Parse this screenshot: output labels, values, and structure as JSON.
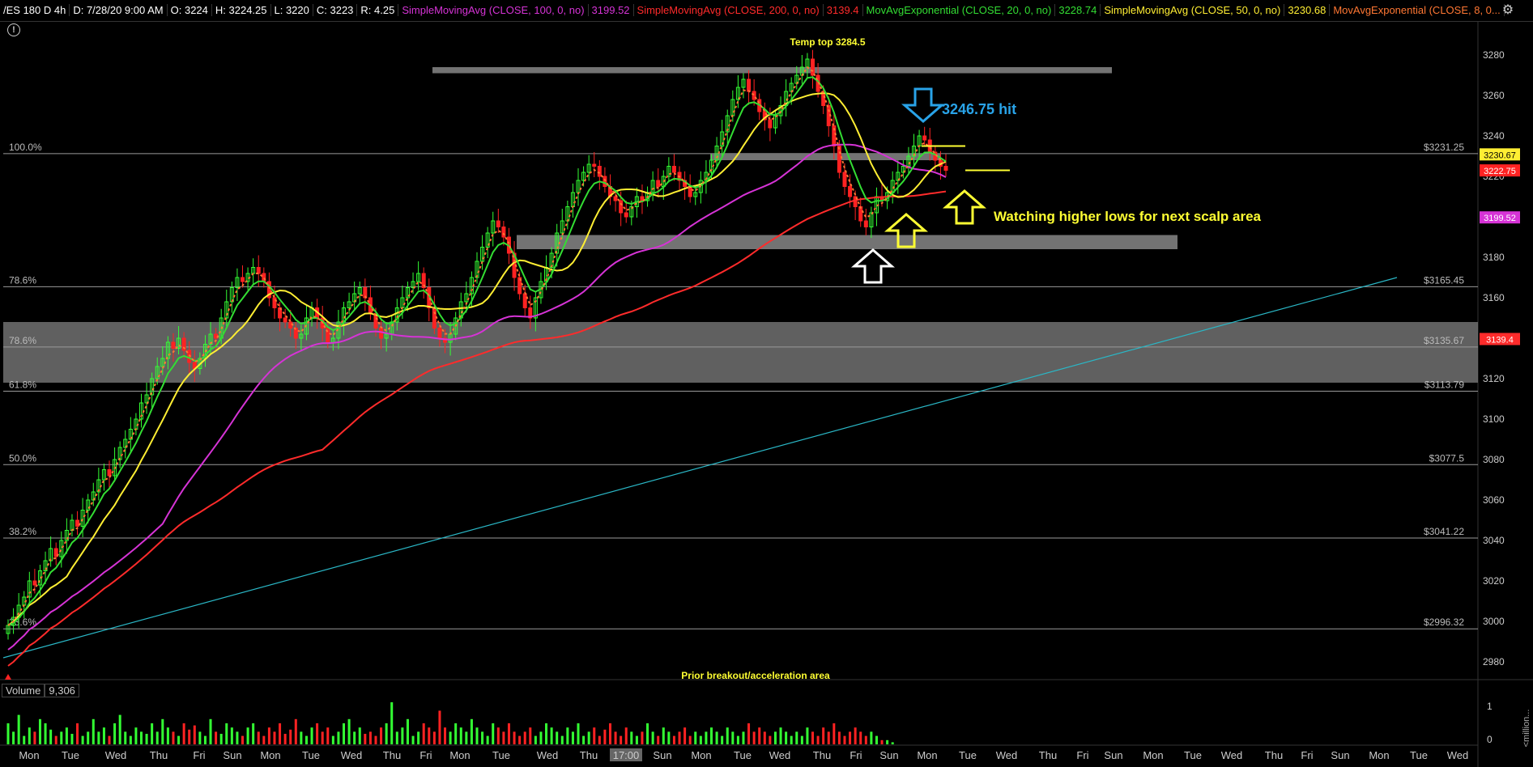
{
  "header": {
    "symbol": "/ES 180 D 4h",
    "date": "D: 7/28/20 9:00 AM",
    "open": "O: 3224",
    "high": "H: 3224.25",
    "low": "L: 3220",
    "close": "C: 3223",
    "range": "R: 4.25",
    "indicators": [
      {
        "label": "SimpleMovingAvg (CLOSE, 100, 0, no)",
        "value": "3199.52",
        "color": "#d633d6"
      },
      {
        "label": "SimpleMovingAvg (CLOSE, 200, 0, no)",
        "value": "3139.4",
        "color": "#ff2b2b"
      },
      {
        "label": "MovAvgExponential (CLOSE, 20, 0, no)",
        "value": "3228.74",
        "color": "#33dd33"
      },
      {
        "label": "SimpleMovingAvg (CLOSE, 50, 0, no)",
        "value": "3230.68",
        "color": "#ffee33"
      },
      {
        "label": "MovAvgExponential (CLOSE, 8, 0...",
        "value": "",
        "color": "#ff7733"
      }
    ]
  },
  "volume": {
    "label": "Volume",
    "value": "9,306",
    "axis_label": "<million..."
  },
  "colors": {
    "up": "#33ff33",
    "down": "#ff2222",
    "sma100": "#d633d6",
    "sma200": "#ff2b2b",
    "ema20": "#33dd33",
    "sma50": "#ffee33",
    "ema8": "#ff7733",
    "trend": "#2ab7c6",
    "zone": "#808080",
    "annot_yellow": "#ffff33",
    "annot_blue": "#29a3e8"
  },
  "chart_data": {
    "type": "candlestick",
    "title": "/ES 180 D 4h",
    "y_ticks": [
      2980,
      3000,
      3020,
      3040,
      3060,
      3080,
      3100,
      3120,
      3140,
      3160,
      3180,
      3200,
      3220,
      3240,
      3260,
      3280
    ],
    "ylim": [
      2972,
      3296
    ],
    "x_labels": [
      "Mon",
      "Tue",
      "Wed",
      "Thu",
      "Fri",
      "Sun",
      "Mon",
      "Tue",
      "Wed",
      "Thu",
      "Fri",
      "Mon",
      "Tue",
      "Wed",
      "Thu",
      "17:00",
      "Sun",
      "Mon",
      "Tue",
      "Wed",
      "Thu",
      "Fri",
      "Sun",
      "Mon",
      "Tue",
      "Wed",
      "Thu",
      "Fri",
      "Sun",
      "Mon",
      "Tue",
      "Wed",
      "Thu",
      "Fri",
      "Sun",
      "Mon",
      "Tue",
      "Wed"
    ],
    "highlighted_x_label": "17:00",
    "price_tags": [
      {
        "value": 3230.67,
        "label": "3230.67",
        "bg": "#ffee33"
      },
      {
        "value": 3222.75,
        "label": "3222.75",
        "bg": "#ff2222"
      },
      {
        "value": 3199.52,
        "label": "3199.52",
        "bg": "#d633d6"
      },
      {
        "value": 3139.4,
        "label": "3139.4",
        "bg": "#ff2b2b"
      }
    ],
    "fib_levels": [
      {
        "pct": "100.0%",
        "price": "$3231.25",
        "value": 3231.25
      },
      {
        "pct": "78.6%",
        "price": "$3165.45",
        "value": 3165.45
      },
      {
        "pct": "78.6%",
        "price": "$3135.67",
        "value": 3135.67
      },
      {
        "pct": "61.8%",
        "price": "$3113.79",
        "value": 3113.79
      },
      {
        "pct": "50.0%",
        "price": "$3077.5",
        "value": 3077.5
      },
      {
        "pct": "38.2%",
        "price": "$3041.22",
        "value": 3041.22
      },
      {
        "pct": "23.6%",
        "price": "$2996.32",
        "value": 2996.32
      }
    ],
    "zones": [
      {
        "low": 3271,
        "high": 3274
      },
      {
        "low": 3228,
        "high": 3231
      },
      {
        "low": 3184,
        "high": 3191
      },
      {
        "low": 3118,
        "high": 3148
      }
    ],
    "annotations": {
      "temp_top": "Temp top  3284.5",
      "hit": "3246.75 hit",
      "watching": "Watching higher lows  for next scalp area",
      "prior": "Prior breakout/acceleration area"
    },
    "volume_axis_ticks": [
      "1",
      "0"
    ],
    "volume_values": [
      0.5,
      0.3,
      0.7,
      0.2,
      0.4,
      0.3,
      0.6,
      0.5,
      0.35,
      0.2,
      0.3,
      0.4,
      0.25,
      0.5,
      0.2,
      0.3,
      0.6,
      0.3,
      0.4,
      0.2,
      0.5,
      0.7,
      0.3,
      0.2,
      0.4,
      0.3,
      0.25,
      0.5,
      0.3,
      0.6,
      0.4,
      0.3,
      0.2,
      0.5,
      0.35,
      0.45,
      0.3,
      0.2,
      0.6,
      0.3,
      0.25,
      0.5,
      0.4,
      0.3,
      0.2,
      0.4,
      0.5,
      0.3,
      0.2,
      0.4,
      0.3,
      0.5,
      0.25,
      0.35,
      0.6,
      0.3,
      0.2,
      0.4,
      0.5,
      0.3,
      0.4,
      0.2,
      0.3,
      0.5,
      0.6,
      0.3,
      0.4,
      0.25,
      0.3,
      0.2,
      0.4,
      0.5,
      1.0,
      0.3,
      0.4,
      0.6,
      0.2,
      0.3,
      0.5,
      0.4,
      0.3,
      0.8,
      0.4,
      0.3,
      0.5,
      0.4,
      0.3,
      0.6,
      0.4,
      0.3,
      0.2,
      0.5,
      0.4,
      0.3,
      0.5,
      0.3,
      0.2,
      0.3,
      0.4,
      0.2,
      0.3,
      0.5,
      0.4,
      0.3,
      0.2,
      0.4,
      0.3,
      0.5,
      0.2,
      0.3,
      0.4,
      0.2,
      0.35,
      0.5,
      0.3,
      0.2,
      0.4,
      0.3,
      0.2,
      0.3,
      0.5,
      0.3,
      0.2,
      0.4,
      0.3,
      0.2,
      0.3,
      0.4,
      0.2,
      0.3,
      0.2,
      0.3,
      0.4,
      0.3,
      0.2,
      0.4,
      0.3,
      0.2,
      0.3,
      0.5,
      0.3,
      0.4,
      0.3,
      0.2,
      0.3,
      0.4,
      0.3,
      0.2,
      0.3,
      0.2,
      0.4,
      0.3,
      0.2,
      0.4,
      0.3,
      0.5,
      0.3,
      0.2,
      0.3,
      0.4,
      0.3,
      0.2,
      0.3,
      0.2,
      0.1,
      0.1,
      0.05
    ],
    "closes": [
      2998,
      3002,
      3008,
      3012,
      3020,
      3018,
      3025,
      3030,
      3036,
      3032,
      3040,
      3045,
      3050,
      3047,
      3055,
      3060,
      3064,
      3070,
      3075,
      3072,
      3080,
      3086,
      3090,
      3095,
      3100,
      3108,
      3112,
      3120,
      3126,
      3130,
      3138,
      3135,
      3140,
      3134,
      3128,
      3125,
      3130,
      3137,
      3142,
      3140,
      3150,
      3158,
      3165,
      3170,
      3168,
      3172,
      3175,
      3172,
      3168,
      3160,
      3155,
      3150,
      3148,
      3145,
      3140,
      3142,
      3150,
      3155,
      3150,
      3145,
      3138,
      3140,
      3148,
      3155,
      3158,
      3162,
      3165,
      3160,
      3152,
      3145,
      3140,
      3142,
      3148,
      3155,
      3160,
      3165,
      3168,
      3172,
      3165,
      3155,
      3145,
      3140,
      3138,
      3142,
      3150,
      3158,
      3162,
      3170,
      3178,
      3185,
      3192,
      3198,
      3195,
      3190,
      3182,
      3170,
      3162,
      3155,
      3150,
      3160,
      3168,
      3175,
      3182,
      3192,
      3198,
      3205,
      3212,
      3218,
      3222,
      3226,
      3225,
      3220,
      3215,
      3210,
      3208,
      3202,
      3200,
      3205,
      3210,
      3208,
      3212,
      3218,
      3215,
      3220,
      3225,
      3222,
      3218,
      3215,
      3210,
      3212,
      3218,
      3222,
      3228,
      3235,
      3242,
      3250,
      3258,
      3264,
      3268,
      3262,
      3258,
      3252,
      3248,
      3244,
      3250,
      3255,
      3262,
      3266,
      3270,
      3274,
      3278,
      3270,
      3262,
      3255,
      3245,
      3235,
      3222,
      3215,
      3210,
      3205,
      3198,
      3195,
      3202,
      3210,
      3208,
      3212,
      3218,
      3222,
      3225,
      3230,
      3235,
      3240,
      3238,
      3232,
      3228,
      3225,
      3223
    ]
  }
}
